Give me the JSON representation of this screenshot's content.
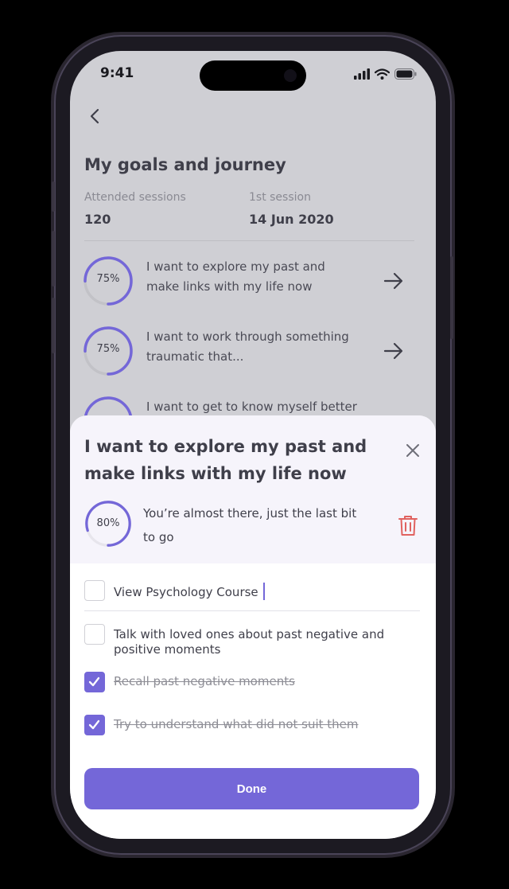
{
  "status_bar": {
    "time": "9:41",
    "signal_icon": "cellular-signal-icon",
    "wifi_icon": "wifi-icon",
    "battery_icon": "battery-icon"
  },
  "header": {
    "back_icon": "chevron-left-icon",
    "title": "My goals and journey"
  },
  "stats": [
    {
      "label": "Attended sessions",
      "value": "120"
    },
    {
      "label": "1st session",
      "value": "14 Jun 2020"
    }
  ],
  "goals": [
    {
      "progress": 0.75,
      "progress_label": "75%",
      "text": "I want to explore my past and make links with my life now",
      "arrow_icon": "arrow-right-icon"
    },
    {
      "progress": 0.75,
      "progress_label": "75%",
      "text": "I want to work through something traumatic that...",
      "arrow_icon": "arrow-right-icon"
    },
    {
      "progress": 0.75,
      "progress_label": "",
      "text": "I want to get to know myself better",
      "arrow_icon": "arrow-right-icon"
    }
  ],
  "sheet": {
    "title": "I want to explore my past and make links with my life now",
    "close_icon": "close-icon",
    "progress": 0.8,
    "progress_label": "80%",
    "note": "You’re almost there, just the last bit to go",
    "delete_icon": "trash-icon",
    "tasks": [
      {
        "text": "View Psychology Course",
        "checked": false
      },
      {
        "text": "Talk with loved ones about past negative and positive moments",
        "checked": false
      },
      {
        "text": "Recall past negative moments",
        "checked": true
      },
      {
        "text": "Try to understand what did not suit them",
        "checked": true
      }
    ],
    "done_label": "Done"
  },
  "colors": {
    "accent": "#7467d8",
    "danger": "#e0625f",
    "text": "#3f3f4a",
    "sheet_header": "#f6f4fb"
  }
}
